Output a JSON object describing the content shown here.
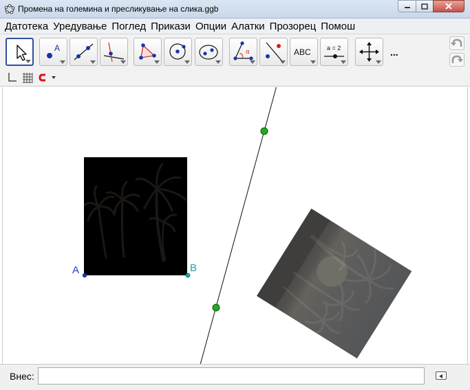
{
  "window": {
    "title": "Промена на големина и пресликување на слика.ggb"
  },
  "menu": [
    "Датотека",
    "Уредување",
    "Поглед",
    "Прикази",
    "Опции",
    "Алатки",
    "Прозорец",
    "Помош"
  ],
  "toolbar": {
    "tools": [
      {
        "name": "move-tool",
        "icon": "arrow-cursor-icon",
        "active": true
      },
      {
        "name": "point-tool",
        "icon": "point-icon",
        "label": "A"
      },
      {
        "name": "line-tool",
        "icon": "line-through-points-icon"
      },
      {
        "name": "perpendicular-tool",
        "icon": "perpendicular-line-icon"
      },
      {
        "name": "polygon-tool",
        "icon": "polygon-icon"
      },
      {
        "name": "circle-tool",
        "icon": "circle-center-point-icon"
      },
      {
        "name": "conic-tool",
        "icon": "ellipse-icon"
      },
      {
        "name": "angle-tool",
        "icon": "angle-icon",
        "label": "α"
      },
      {
        "name": "reflect-tool",
        "icon": "reflect-about-line-icon"
      },
      {
        "name": "text-tool",
        "icon": "text-icon",
        "label": "ABC"
      },
      {
        "name": "slider-tool",
        "icon": "slider-icon",
        "label": "a = 2"
      },
      {
        "name": "move-view-tool",
        "icon": "move-graphics-view-icon"
      }
    ],
    "more_label": "..."
  },
  "graphics": {
    "point_a_label": "A",
    "point_b_label": "B",
    "colors": {
      "line": "#222222",
      "mirror_point": "#22aa22",
      "point_a": "#1a33a8",
      "point_b_label": "#1aa6b0",
      "point_a_label": "#2c40b8"
    }
  },
  "input_bar": {
    "label": "Внес:",
    "value": ""
  }
}
